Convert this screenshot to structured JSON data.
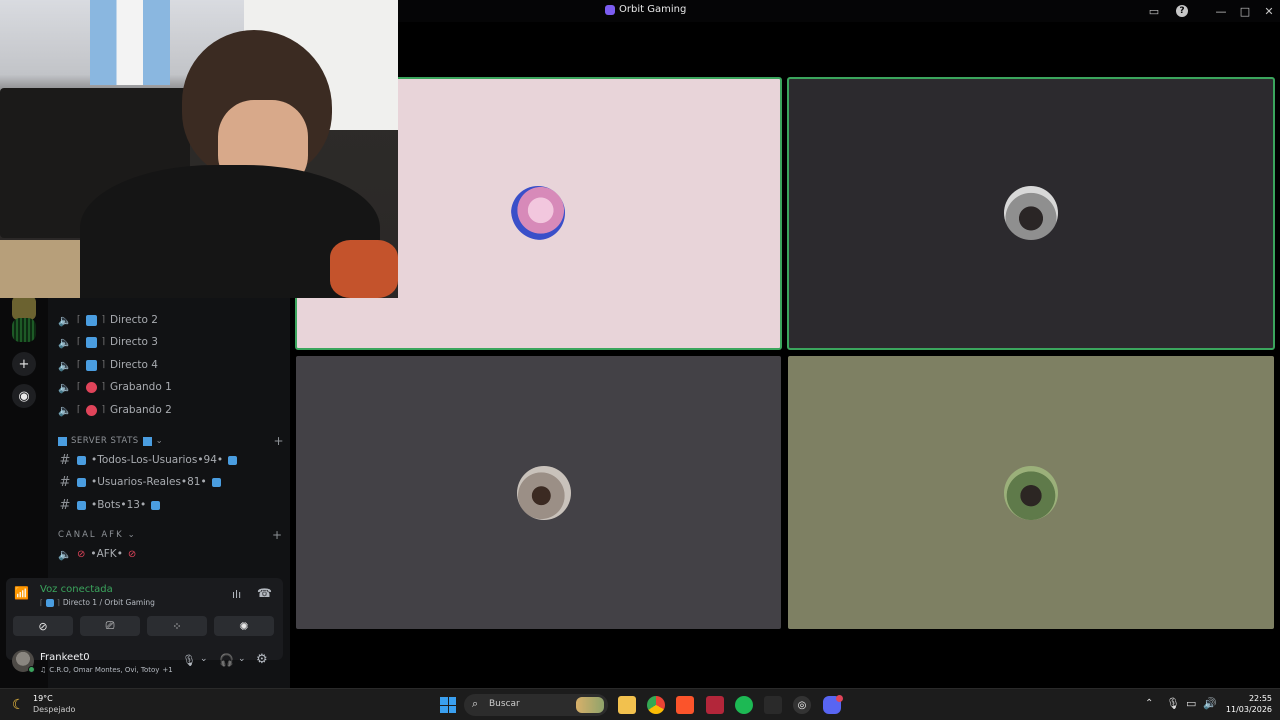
{
  "window": {
    "title": "Orbit Gaming"
  },
  "channels": {
    "voice": [
      {
        "label": "Directo 2",
        "tag_color": "#4a9de0"
      },
      {
        "label": "Directo 3",
        "tag_color": "#4a9de0"
      },
      {
        "label": "Directo 4",
        "tag_color": "#4a9de0"
      },
      {
        "label": "Grabando 1",
        "tag_color": "#e0445a"
      },
      {
        "label": "Grabando 2",
        "tag_color": "#e0445a"
      }
    ],
    "stats_category": "SERVER STATS",
    "stats": [
      {
        "label": "•Todos-Los-Usuarios•94•"
      },
      {
        "label": "•Usuarios-Reales•81•"
      },
      {
        "label": "•Bots•13•"
      }
    ],
    "afk_category": "CANAL AFK",
    "afk_channel": "•AFK•"
  },
  "voice_panel": {
    "status": "Voz conectada",
    "location": "Directo 1 / Orbit Gaming",
    "status_color": "#3ba55d"
  },
  "user": {
    "name": "Frankeet0",
    "activity": "C.R.O, Omar Montes, Ovi, Totoy",
    "activity_extra": "+1"
  },
  "tiles": [
    {
      "name": "tile-1",
      "bg": "#e8d4d9",
      "speaking": true
    },
    {
      "name": "tile-2",
      "bg": "#2c2a2e",
      "speaking": true
    },
    {
      "name": "tile-3",
      "bg": "#434146",
      "speaking": false
    },
    {
      "name": "tile-4",
      "bg": "#7e8063",
      "speaking": false
    }
  ],
  "taskbar": {
    "weather_temp": "19°C",
    "weather_desc": "Despejado",
    "search_placeholder": "Buscar",
    "time": "22:55",
    "date": "11/03/2026"
  }
}
